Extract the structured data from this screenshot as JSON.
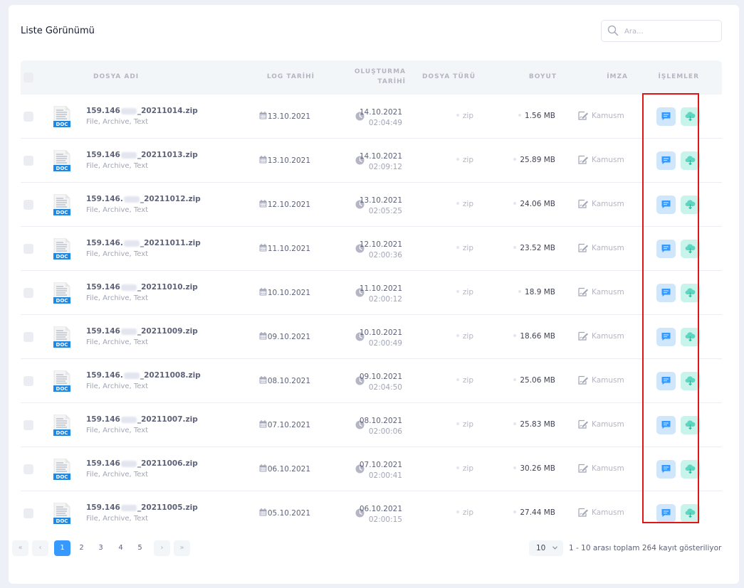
{
  "title": "Liste Görünümü",
  "search": {
    "placeholder": "Ara..."
  },
  "columns": {
    "name": "DOSYA ADI",
    "log_date": "LOG TARİHİ",
    "created_line1": "OLUŞTURMA",
    "created_line2": "TARİHİ",
    "type": "DOSYA TÜRÜ",
    "size": "BOYUT",
    "signature": "İMZA",
    "actions": "İŞLEMLER"
  },
  "rows": [
    {
      "name_prefix": "159.146",
      "name_suffix": "_20211014.zip",
      "kind": "File, Archive, Text",
      "log_date": "13.10.2021",
      "created_date": "14.10.2021",
      "created_time": "02:04:49",
      "ext": "zip",
      "size": "1.56 MB",
      "signer": "Kamusm"
    },
    {
      "name_prefix": "159.146",
      "name_suffix": "_20211013.zip",
      "kind": "File, Archive, Text",
      "log_date": "13.10.2021",
      "created_date": "14.10.2021",
      "created_time": "02:09:12",
      "ext": "zip",
      "size": "25.89 MB",
      "signer": "Kamusm"
    },
    {
      "name_prefix": "159.146.",
      "name_suffix": "_20211012.zip",
      "kind": "File, Archive, Text",
      "log_date": "12.10.2021",
      "created_date": "13.10.2021",
      "created_time": "02:05:25",
      "ext": "zip",
      "size": "24.06 MB",
      "signer": "Kamusm"
    },
    {
      "name_prefix": "159.146.",
      "name_suffix": "_20211011.zip",
      "kind": "File, Archive, Text",
      "log_date": "11.10.2021",
      "created_date": "12.10.2021",
      "created_time": "02:00:36",
      "ext": "zip",
      "size": "23.52 MB",
      "signer": "Kamusm"
    },
    {
      "name_prefix": "159.146",
      "name_suffix": "_20211010.zip",
      "kind": "File, Archive, Text",
      "log_date": "10.10.2021",
      "created_date": "11.10.2021",
      "created_time": "02:00:12",
      "ext": "zip",
      "size": "18.9 MB",
      "signer": "Kamusm"
    },
    {
      "name_prefix": "159.146",
      "name_suffix": "_20211009.zip",
      "kind": "File, Archive, Text",
      "log_date": "09.10.2021",
      "created_date": "10.10.2021",
      "created_time": "02:00:49",
      "ext": "zip",
      "size": "18.66 MB",
      "signer": "Kamusm"
    },
    {
      "name_prefix": "159.146.",
      "name_suffix": "_20211008.zip",
      "kind": "File, Archive, Text",
      "log_date": "08.10.2021",
      "created_date": "09.10.2021",
      "created_time": "02:04:50",
      "ext": "zip",
      "size": "25.06 MB",
      "signer": "Kamusm"
    },
    {
      "name_prefix": "159.146",
      "name_suffix": "_20211007.zip",
      "kind": "File, Archive, Text",
      "log_date": "07.10.2021",
      "created_date": "08.10.2021",
      "created_time": "02:00:06",
      "ext": "zip",
      "size": "25.83 MB",
      "signer": "Kamusm"
    },
    {
      "name_prefix": "159.146",
      "name_suffix": "_20211006.zip",
      "kind": "File, Archive, Text",
      "log_date": "06.10.2021",
      "created_date": "07.10.2021",
      "created_time": "02:00:41",
      "ext": "zip",
      "size": "30.26 MB",
      "signer": "Kamusm"
    },
    {
      "name_prefix": "159.146",
      "name_suffix": "_20211005.zip",
      "kind": "File, Archive, Text",
      "log_date": "05.10.2021",
      "created_date": "06.10.2021",
      "created_time": "02:00:15",
      "ext": "zip",
      "size": "27.44 MB",
      "signer": "Kamusm"
    }
  ],
  "icons": {
    "search": "search-icon",
    "file": "doc-file-icon",
    "log_date": "calendar-icon",
    "created": "clock-icon",
    "signature": "signature-icon",
    "action_message": "message-icon",
    "action_download": "cloud-download-icon"
  },
  "pagination": {
    "first": "«",
    "prev": "‹",
    "pages": [
      "1",
      "2",
      "3",
      "4",
      "5"
    ],
    "current_page": "1",
    "next": "›",
    "last": "»",
    "per_page": "10",
    "info": "1 - 10 arası toplam 264 kayıt gösteriliyor"
  },
  "colors": {
    "accent": "#3699ff",
    "highlight_box": "#e01515",
    "message_button_bg": "#cfe6fb",
    "download_button_bg": "#c9f4ec",
    "doc_icon_blue": "#1e88e5"
  }
}
